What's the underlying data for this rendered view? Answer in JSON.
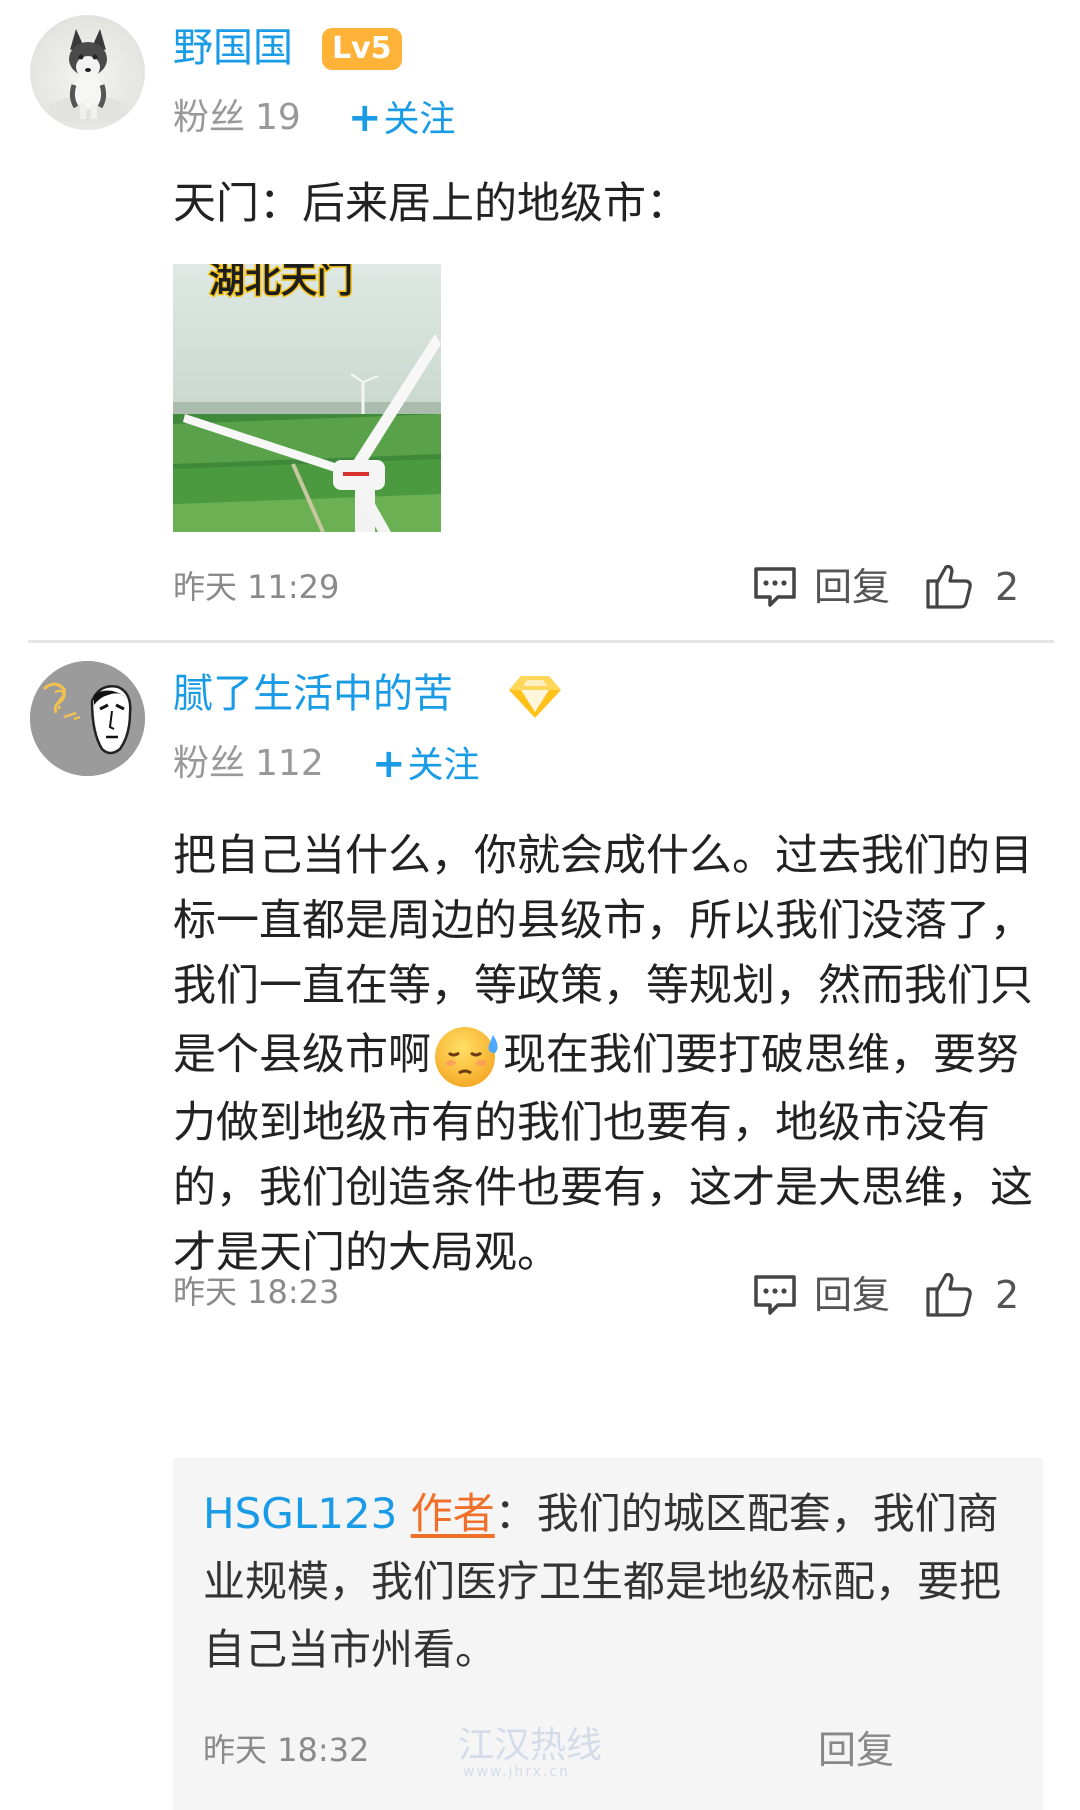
{
  "comments": [
    {
      "username": "野国国",
      "level": "Lv5",
      "fans_label": "粉丝",
      "fans_count": "19",
      "follow_label": "关注",
      "text": "天门：后来居上的地级市：",
      "image_caption": "湖北天门",
      "time": "昨天 11:29",
      "reply_label": "回复",
      "like_count": "2"
    },
    {
      "username": "腻了生活中的苦",
      "fans_label": "粉丝",
      "fans_count": "112",
      "follow_label": "关注",
      "text_before_emoji": "把自己当什么，你就会成什么。过去我们的目标一直都是周边的县级市，所以我们没落了，我们一直在等，等政策，等规划，然而我们只是个县级市啊",
      "emoji": "sweat-emoji",
      "text_after_emoji": "现在我们要打破思维，要努力做到地级市有的我们也要有，地级市没有的，我们创造条件也要有，这才是大思维，这才是天门的大局观。",
      "time": "昨天 18:23",
      "reply_label": "回复",
      "like_count": "2",
      "sub_reply": {
        "username": "HSGL123",
        "author_tag": "作者",
        "separator": "：",
        "text": "我们的城区配套，我们商业规模，我们医疗卫生都是地级标配，要把自己当市州看。",
        "time": "昨天 18:32",
        "reply_label": "回复"
      }
    }
  ],
  "watermark": {
    "text": "江汉热线",
    "url": "www.jhrx.cn"
  },
  "colors": {
    "link_blue": "#1a9be6",
    "level_badge": "#ffb238",
    "author_orange": "#f0702a"
  }
}
